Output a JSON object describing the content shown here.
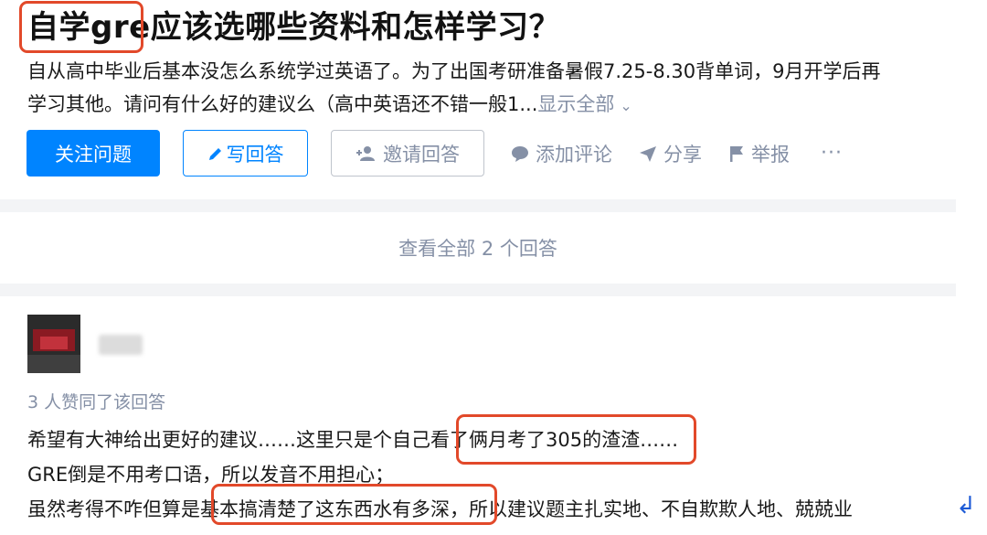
{
  "question": {
    "title": "自学gre应该选哪些资料和怎样学习？",
    "detail_line1": "自从高中毕业后基本没怎么系统学过英语了。为了出国考研准备暑假7.25-8.30背单词，9月开学后再",
    "detail_line2": "学习其他。请问有什么好的建议么（高中英语还不错一般1...",
    "show_all": "显示全部",
    "chevron_icon": "chevron-down-icon"
  },
  "actions": {
    "follow": "关注问题",
    "write": "写回答",
    "invite": "邀请回答",
    "comment": "添加评论",
    "share": "分享",
    "report": "举报",
    "more": "···"
  },
  "view_all_answers": "查看全部 2 个回答",
  "answer": {
    "vote_text": "3 人赞同了该回答",
    "line1": "希望有大神给出更好的建议……这里只是个自己看了俩月考了305的渣渣……",
    "line2": "GRE倒是不用考口语，所以发音不用担心；",
    "line3": "虽然考得不咋但算是基本搞清楚了这东西水有多深，所以建议题主扎实地、不自欺欺人地、兢兢业"
  },
  "colors": {
    "primary": "#0084ff",
    "muted": "#8590a6",
    "highlight": "#e2492a",
    "separator": "#f3f4f6"
  }
}
